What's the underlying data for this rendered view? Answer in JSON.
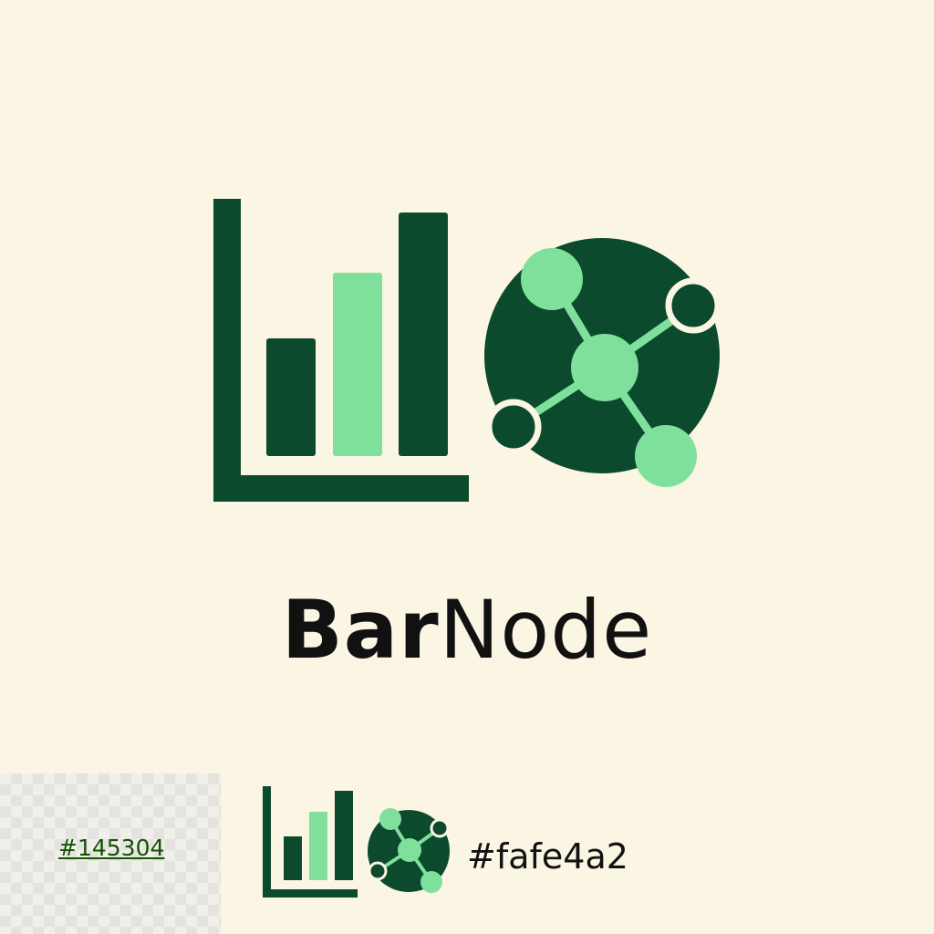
{
  "brand": {
    "name_bold": "Bar",
    "name_regular": "Node"
  },
  "colors": {
    "background": "#fbf5e3",
    "dark_green": "#0b4a2c",
    "light_green": "#7fe09c",
    "text": "#111111"
  },
  "swatches": {
    "primary_hex": "#145304",
    "secondary_hex": "#fafe4a2"
  },
  "icons": {
    "bar_chart": "bar-chart-icon",
    "network": "network-node-icon"
  }
}
